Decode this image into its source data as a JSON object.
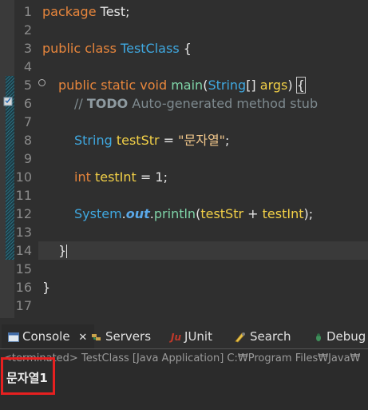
{
  "editor": {
    "line_numbers": [
      "1",
      "2",
      "3",
      "4",
      "5",
      "6",
      "7",
      "8",
      "9",
      "10",
      "11",
      "12",
      "13",
      "14",
      "15",
      "16",
      "17"
    ],
    "fold_marker_line": "5",
    "l1": {
      "kw": "package",
      "rest": " Test;"
    },
    "l3": {
      "kw": "public class",
      "cls": "TestClass",
      "rest": " {"
    },
    "l5": {
      "kw": "public static void",
      "meth": "main",
      "paren": "(",
      "type": "String",
      "arr": "[] ",
      "param": "args",
      "close": ") ",
      "brace": "{"
    },
    "l6": {
      "slashes": "// ",
      "todo": "TODO",
      "comment": " Auto-generated method stub"
    },
    "l8": {
      "type": "String",
      "var": "testStr",
      "eq": " = ",
      "str": "\"문자열\"",
      "end": ";"
    },
    "l10": {
      "kw": "int",
      "var": "testInt",
      "eq": " = ",
      "num": "1",
      "end": ";"
    },
    "l12": {
      "cls": "System",
      "dot1": ".",
      "field": "out",
      "dot2": ".",
      "meth": "println",
      "open": "(",
      "a": "testStr",
      "plus": " + ",
      "b": "testInt",
      "end": ");"
    },
    "l14": {
      "brace": "}"
    },
    "l16": {
      "brace": "}"
    }
  },
  "tabs": [
    {
      "label": "Console",
      "close": "✕"
    },
    {
      "label": "Servers"
    },
    {
      "label": "JUnit"
    },
    {
      "label": "Search"
    },
    {
      "label": "Debug"
    }
  ],
  "console": {
    "terminated_line": "<terminated> TestClass [Java Application] C:₩Program Files₩Java₩",
    "output": "문자열1"
  },
  "colors": {
    "highlight_box": "#e62020",
    "keyword": "#e8863c",
    "type": "#3fa8e0",
    "variable": "#f2d047"
  }
}
